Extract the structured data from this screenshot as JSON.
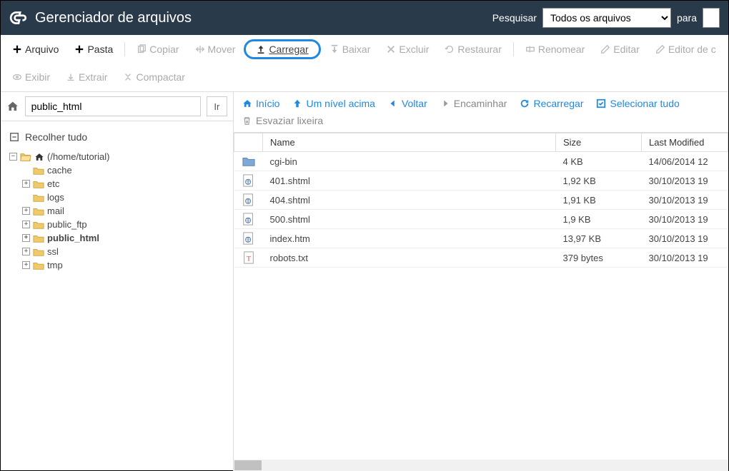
{
  "header": {
    "title": "Gerenciador de arquivos",
    "search_label": "Pesquisar",
    "search_scope": "Todos os arquivos",
    "for_label": "para"
  },
  "toolbar": {
    "file": "Arquivo",
    "folder": "Pasta",
    "copy": "Copiar",
    "move": "Mover",
    "upload": "Carregar",
    "download": "Baixar",
    "delete": "Excluir",
    "restore": "Restaurar",
    "rename": "Renomear",
    "edit": "Editar",
    "code_editor": "Editor de c",
    "view": "Exibir",
    "extract": "Extrair",
    "compress": "Compactar"
  },
  "path": {
    "value": "public_html",
    "go": "Ir"
  },
  "nav": {
    "home": "Início",
    "up": "Um nível acima",
    "back": "Voltar",
    "forward": "Encaminhar",
    "reload": "Recarregar",
    "select_all": "Selecionar tudo",
    "empty_trash": "Esvaziar lixeira"
  },
  "sidebar": {
    "collapse_all": "Recolher tudo",
    "root": "(/home/tutorial)",
    "items": [
      {
        "label": "cache",
        "exp": ""
      },
      {
        "label": "etc",
        "exp": "+"
      },
      {
        "label": "logs",
        "exp": ""
      },
      {
        "label": "mail",
        "exp": "+"
      },
      {
        "label": "public_ftp",
        "exp": "+"
      },
      {
        "label": "public_html",
        "exp": "+",
        "bold": true
      },
      {
        "label": "ssl",
        "exp": "+"
      },
      {
        "label": "tmp",
        "exp": "+"
      }
    ]
  },
  "table": {
    "cols": {
      "name": "Name",
      "size": "Size",
      "modified": "Last Modified"
    },
    "rows": [
      {
        "icon": "folder",
        "name": "cgi-bin",
        "size": "4 KB",
        "modified": "14/06/2014 12"
      },
      {
        "icon": "globe",
        "name": "401.shtml",
        "size": "1,92 KB",
        "modified": "30/10/2013 19"
      },
      {
        "icon": "globe",
        "name": "404.shtml",
        "size": "1,91 KB",
        "modified": "30/10/2013 19"
      },
      {
        "icon": "globe",
        "name": "500.shtml",
        "size": "1,9 KB",
        "modified": "30/10/2013 19"
      },
      {
        "icon": "globe",
        "name": "index.htm",
        "size": "13,97 KB",
        "modified": "30/10/2013 19"
      },
      {
        "icon": "text",
        "name": "robots.txt",
        "size": "379 bytes",
        "modified": "30/10/2013 19"
      }
    ]
  }
}
